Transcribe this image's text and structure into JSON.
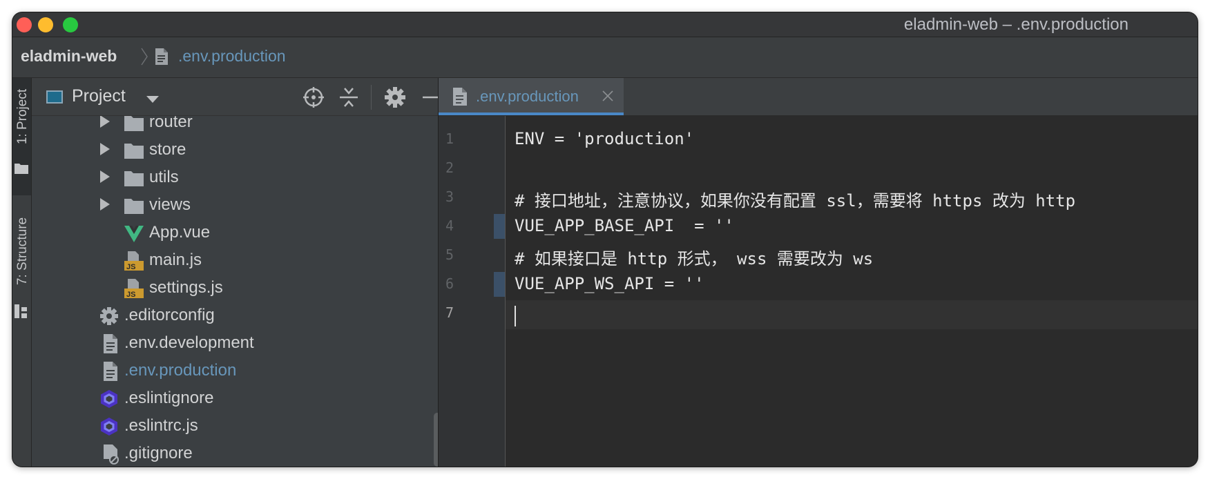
{
  "window": {
    "title": "eladmin-web – .env.production",
    "traffic_lights": {
      "close": "#ff5f57",
      "minimize": "#febc2e",
      "zoom": "#28c840"
    }
  },
  "breadcrumb": {
    "project": "eladmin-web",
    "file": ".env.production"
  },
  "left_strip": {
    "project_tab": "1: Project",
    "structure_tab": "7: Structure"
  },
  "project_panel": {
    "title": "Project",
    "toolbar_icons": [
      "locate-icon",
      "collapse-all-icon",
      "gear-icon",
      "hide-icon"
    ],
    "tree": [
      {
        "label": "router",
        "icon": "folder-icon",
        "expandable": true
      },
      {
        "label": "store",
        "icon": "folder-icon",
        "expandable": true
      },
      {
        "label": "utils",
        "icon": "folder-icon",
        "expandable": true
      },
      {
        "label": "views",
        "icon": "folder-icon",
        "expandable": true
      },
      {
        "label": "App.vue",
        "icon": "vue-icon",
        "expandable": false
      },
      {
        "label": "main.js",
        "icon": "js-file-icon",
        "expandable": false
      },
      {
        "label": "settings.js",
        "icon": "js-file-icon",
        "expandable": false
      },
      {
        "label": ".editorconfig",
        "icon": "gear-file-icon",
        "expandable": false
      },
      {
        "label": ".env.development",
        "icon": "text-file-icon",
        "expandable": false
      },
      {
        "label": ".env.production",
        "icon": "text-file-icon",
        "expandable": false,
        "selected": true
      },
      {
        "label": ".eslintignore",
        "icon": "eslint-icon",
        "expandable": false
      },
      {
        "label": ".eslintrc.js",
        "icon": "eslint-icon",
        "expandable": false
      },
      {
        "label": ".gitignore",
        "icon": "ignore-file-icon",
        "expandable": false
      }
    ]
  },
  "editor": {
    "tab": ".env.production",
    "current_line": 7,
    "lines": [
      {
        "num": "1",
        "text": "ENV = 'production'",
        "modified": false
      },
      {
        "num": "2",
        "text": "",
        "modified": false
      },
      {
        "num": "3",
        "text": "# 接口地址，注意协议，如果你没有配置 ssl，需要将 https 改为 http",
        "modified": false
      },
      {
        "num": "4",
        "text": "VUE_APP_BASE_API  = ''",
        "modified": true
      },
      {
        "num": "5",
        "text": "# 如果接口是 http 形式， wss 需要改为 ws",
        "modified": false
      },
      {
        "num": "6",
        "text": "VUE_APP_WS_API = ''",
        "modified": true
      },
      {
        "num": "7",
        "text": "",
        "modified": false
      }
    ]
  }
}
